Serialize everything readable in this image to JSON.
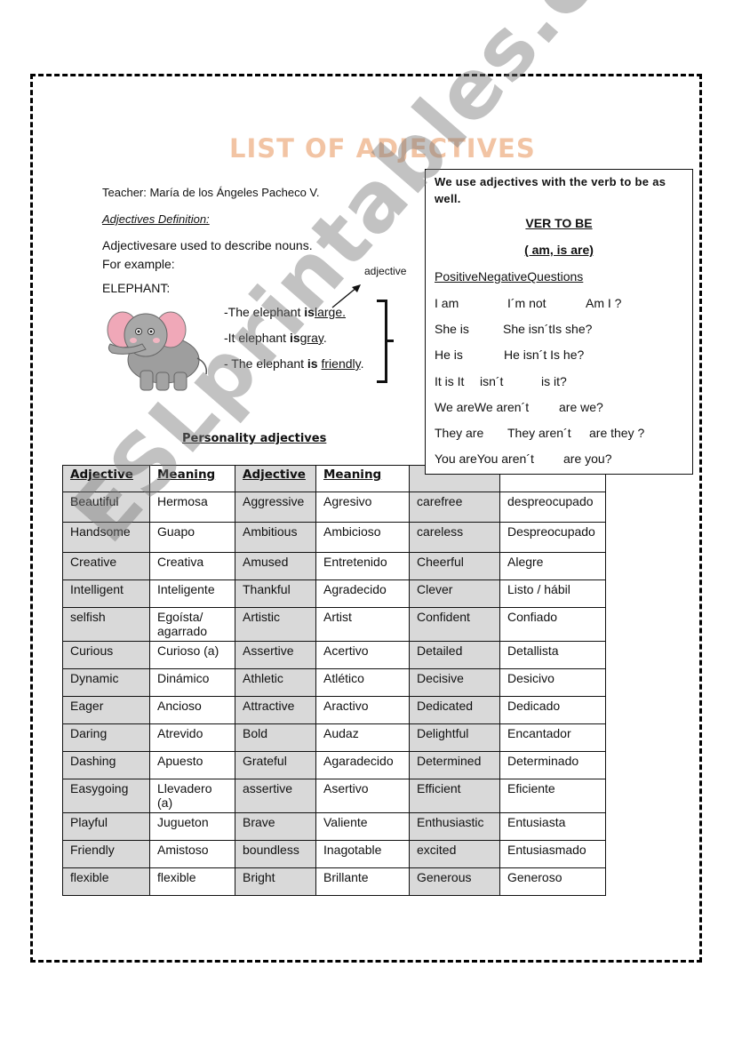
{
  "page": {
    "title": "LIST OF ADJECTIVES",
    "teacher": "Teacher: María de los Ángeles Pacheco V.",
    "definition_heading": "Adjectives Definition:",
    "definition_line1": "Adjectivesare used to describe nouns.",
    "definition_line2": "For example:",
    "example_noun": "ELEPHANT:",
    "adjective_callout": "adjective",
    "sentences": [
      {
        "prefix": "-The elephant ",
        "verb": "is",
        "adjective": "large."
      },
      {
        "prefix": "-It elephant ",
        "verb": "is",
        "adjective": "gray",
        "suffix": "."
      },
      {
        "prefix": "- The elephant ",
        "verb": "is",
        "adjective": "friendly",
        "suffix": "."
      }
    ],
    "watermark": "ESLprintables.com"
  },
  "verb_box": {
    "intro": "We use adjectives with the verb to be as well.",
    "title": "VER TO BE",
    "subtitle": "( am, is are)",
    "header": "PositiveNegativeQuestions",
    "rows": [
      {
        "positive": "I  am",
        "negative": "I´m not",
        "question": "Am I ?"
      },
      {
        "positive": "She is",
        "negative": "She isn´tIs she?",
        "question": ""
      },
      {
        "positive": "He is",
        "negative": "He isn´t Is he?",
        "question": ""
      },
      {
        "positive": "It is It",
        "negative": "isn´t",
        "question": "is it?"
      },
      {
        "positive": "We areWe aren´t",
        "negative": "",
        "question": "are we?"
      },
      {
        "positive": "They are",
        "negative": "They aren´t",
        "question": "are they ?"
      },
      {
        "positive": "You areYou aren´t",
        "negative": "",
        "question": "are you?"
      }
    ]
  },
  "table": {
    "section_title": "Personality adjectives",
    "headers": [
      "Adjective",
      "Meaning",
      "Adjective",
      "Meaning",
      "",
      ""
    ],
    "rows": [
      [
        "Beautiful",
        "Hermosa",
        "Aggressive",
        "Agresivo",
        "carefree",
        "despreocupado"
      ],
      [
        "Handsome",
        "Guapo",
        "Ambitious",
        "Ambicioso",
        "careless",
        "Despreocupado"
      ],
      [
        "Creative",
        "Creativa",
        "Amused",
        "Entretenido",
        "Cheerful",
        "Alegre"
      ],
      [
        "Intelligent",
        "Inteligente",
        "Thankful",
        "Agradecido",
        "Clever",
        "Listo / hábil"
      ],
      [
        "selfish",
        "Egoísta/ agarrado",
        "Artistic",
        "Artist",
        "Confident",
        "Confiado"
      ],
      [
        "Curious",
        "Curioso (a)",
        "Assertive",
        "Acertivo",
        "Detailed",
        "Detallista"
      ],
      [
        "Dynamic",
        "Dinámico",
        "Athletic",
        "Atlético",
        "Decisive",
        "Desicivo"
      ],
      [
        "Eager",
        "Ancioso",
        "Attractive",
        "Aractivo",
        "Dedicated",
        "Dedicado"
      ],
      [
        "Daring",
        "Atrevido",
        "Bold",
        "Audaz",
        "Delightful",
        "Encantador"
      ],
      [
        "Dashing",
        "Apuesto",
        "Grateful",
        "Agaradecido",
        "Determined",
        "Determinado"
      ],
      [
        "Easygoing",
        "Llevadero (a)",
        "assertive",
        "Asertivo",
        "Efficient",
        "Eficiente"
      ],
      [
        "Playful",
        "Jugueton",
        "Brave",
        "Valiente",
        "Enthusiastic",
        "Entusiasta"
      ],
      [
        "Friendly",
        "Amistoso",
        "boundless",
        "Inagotable",
        "excited",
        "Entusiasmado"
      ],
      [
        "flexible",
        "flexible",
        "Bright",
        "Brillante",
        "Generous",
        "Generoso"
      ]
    ]
  }
}
